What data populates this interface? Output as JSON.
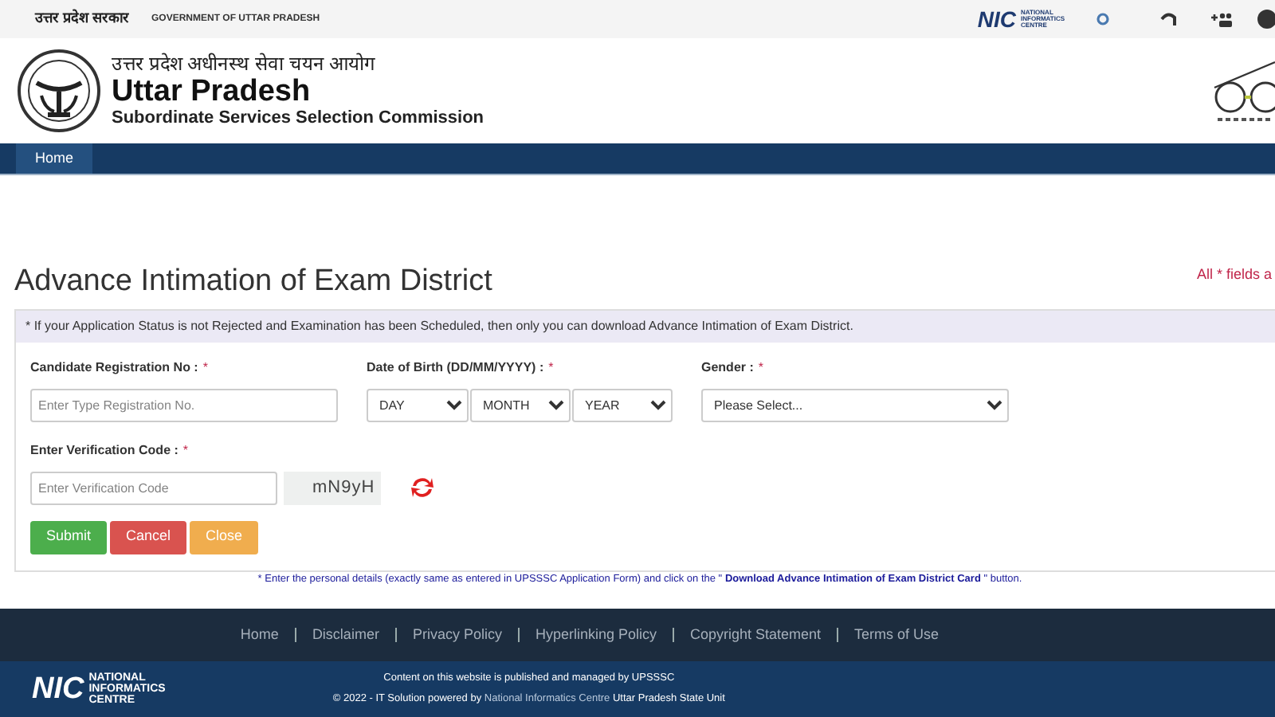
{
  "top_bar": {
    "hindi_label": "उत्तर प्रदेश सरकार",
    "english_label": "GOVERNMENT OF UTTAR PRADESH",
    "nic_logo": {
      "mark": "NIC",
      "lines": [
        "NATIONAL",
        "INFORMATICS",
        "CENTRE"
      ]
    }
  },
  "header": {
    "hindi_title": "उत्तर प्रदेश अधीनस्थ सेवा चयन आयोग",
    "title": "Uttar Pradesh",
    "subtitle": "Subordinate Services Selection Commission"
  },
  "nav": {
    "tabs": [
      {
        "label": "Home",
        "selected": true
      }
    ]
  },
  "page": {
    "title": "Advance Intimation of Exam District",
    "required_note": "All * fields a",
    "info": "* If your Application Status is not Rejected and Examination has been Scheduled, then only you can download Advance Intimation of Exam District.",
    "registration": {
      "label": "Candidate Registration No :",
      "required": "*",
      "placeholder": "Enter Type Registration No."
    },
    "dob": {
      "label": "Date of Birth (DD/MM/YYYY) :",
      "required": "*",
      "selects": [
        "DAY",
        "MONTH",
        "YEAR"
      ]
    },
    "gender": {
      "label": "Gender :",
      "required": "*",
      "value": "Please Select..."
    },
    "verification": {
      "label": "Enter Verification Code :",
      "required": "*",
      "placeholder": "Enter Verification Code",
      "captcha": "mN9yH"
    },
    "buttons": [
      {
        "label": "Submit",
        "kind": "success"
      },
      {
        "label": "Cancel",
        "kind": "danger"
      },
      {
        "label": "Close",
        "kind": "warning"
      }
    ],
    "note": "* Enter the personal details (exactly same as entered in UPSSSC Application Form) and click on the \" **Download Advance Intimation of Exam District Card** \" button."
  },
  "footer": {
    "links": [
      "Home",
      "Disclaimer",
      "Privacy Policy",
      "Hyperlinking Policy",
      "Copyright Statement",
      "Terms of Use"
    ],
    "nic_logo": {
      "mark": "NIC",
      "lines": [
        "NATIONAL",
        "INFORMATICS",
        "CENTRE"
      ]
    },
    "line_1": "Content on this website is published and managed by UPSSSC",
    "line_2": {
      "before": "© 2022 - IT Solution powered by ",
      "link": "National Informatics Centre",
      "after": " Uttar Pradesh State Unit"
    }
  }
}
